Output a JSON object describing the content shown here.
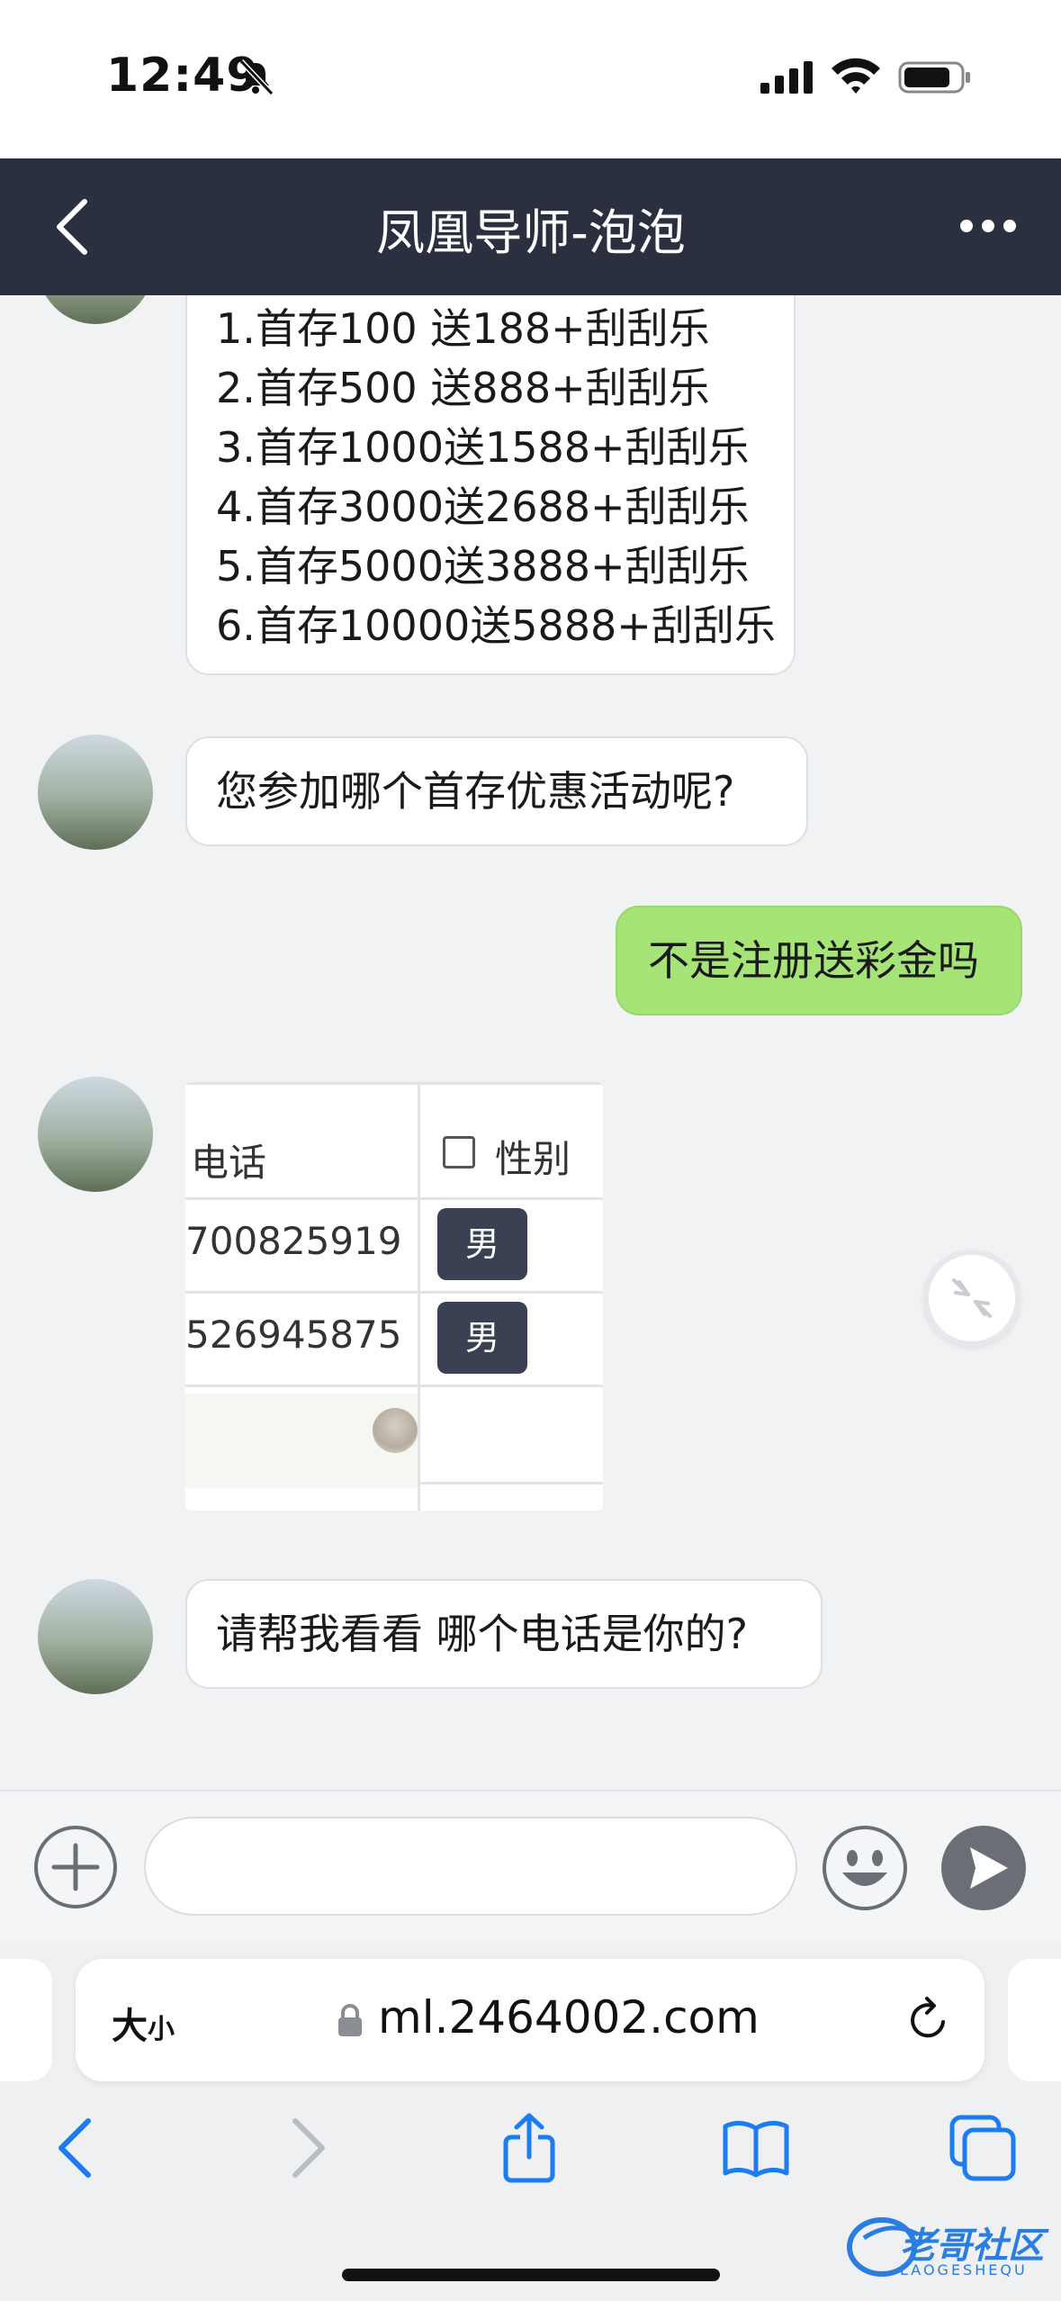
{
  "status_bar": {
    "time": "12:49"
  },
  "nav": {
    "title": "凤凰导师-泡泡"
  },
  "messages": {
    "promo_lines": [
      "1.首存100 送188+刮刮乐",
      "2.首存500 送888+刮刮乐",
      "3.首存1000送1588+刮刮乐",
      "4.首存3000送2688+刮刮乐",
      "5.首存5000送3888+刮刮乐",
      "6.首存10000送5888+刮刮乐"
    ],
    "question": "您参加哪个首存优惠活动呢?",
    "reply": "不是注册送彩金吗",
    "table_image": {
      "col_phone": "电话",
      "col_gender": "性别",
      "rows": [
        {
          "phone": "700825919",
          "gender": "男"
        },
        {
          "phone": "526945875",
          "gender": "男"
        }
      ]
    },
    "request": "请帮我看看 哪个电话是你的?"
  },
  "input_bar": {
    "placeholder": ""
  },
  "safari": {
    "size_label": "大",
    "size_label_small": "小",
    "url": "ml.2464002.com"
  },
  "watermark": {
    "text": "老哥社区",
    "sub": "LAOGESHEQU"
  },
  "colors": {
    "nav_bg": "#2b3041",
    "my_bubble": "#a6e478",
    "ios_blue": "#1e7cf2"
  }
}
